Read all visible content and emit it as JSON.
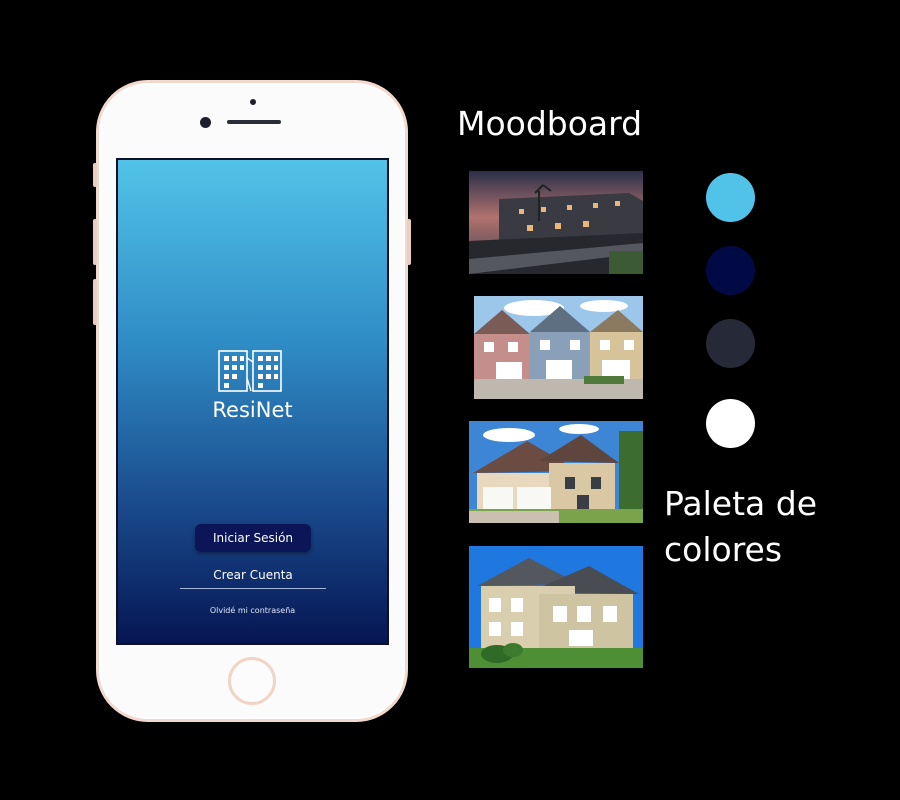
{
  "phone": {
    "app_name": "ResiNet",
    "buttons": {
      "login_label": "Iniciar Sesión",
      "signup_label": "Crear Cuenta",
      "forgot_label": "Olvidé mi contraseña"
    },
    "icon": "building-logo-icon"
  },
  "moodboard": {
    "title": "Moodboard",
    "images": [
      {
        "icon": "townhouses-dusk-photo"
      },
      {
        "icon": "row-houses-photo"
      },
      {
        "icon": "suburban-house-photo"
      },
      {
        "icon": "two-story-house-photo"
      }
    ]
  },
  "palette": {
    "title_line1": "Paleta de",
    "title_line2": "colores",
    "colors": [
      "#52c3e8",
      "#020a45",
      "#262a38",
      "#ffffff"
    ]
  },
  "colors": {
    "background": "#000000",
    "screen_top": "#52c3e8",
    "screen_bottom": "#061653",
    "login_button": "#0b1557"
  }
}
